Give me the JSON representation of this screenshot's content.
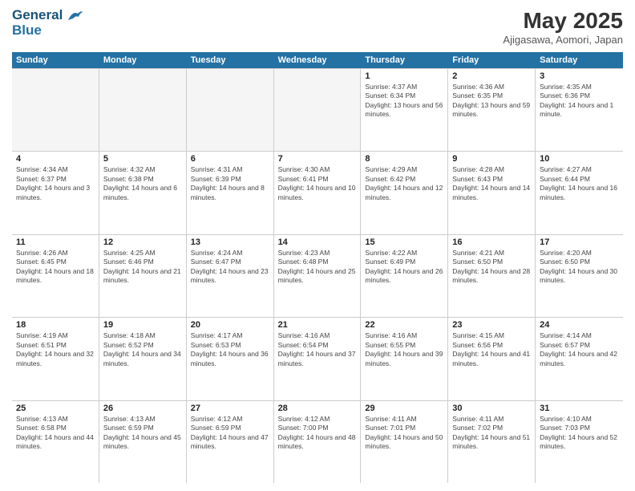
{
  "header": {
    "logo_line1": "General",
    "logo_line2": "Blue",
    "month": "May 2025",
    "location": "Ajigasawa, Aomori, Japan"
  },
  "days_of_week": [
    "Sunday",
    "Monday",
    "Tuesday",
    "Wednesday",
    "Thursday",
    "Friday",
    "Saturday"
  ],
  "rows": [
    [
      {
        "day": "",
        "empty": true
      },
      {
        "day": "",
        "empty": true
      },
      {
        "day": "",
        "empty": true
      },
      {
        "day": "",
        "empty": true
      },
      {
        "day": "1",
        "sunrise": "Sunrise: 4:37 AM",
        "sunset": "Sunset: 6:34 PM",
        "daylight": "Daylight: 13 hours and 56 minutes."
      },
      {
        "day": "2",
        "sunrise": "Sunrise: 4:36 AM",
        "sunset": "Sunset: 6:35 PM",
        "daylight": "Daylight: 13 hours and 59 minutes."
      },
      {
        "day": "3",
        "sunrise": "Sunrise: 4:35 AM",
        "sunset": "Sunset: 6:36 PM",
        "daylight": "Daylight: 14 hours and 1 minute."
      }
    ],
    [
      {
        "day": "4",
        "sunrise": "Sunrise: 4:34 AM",
        "sunset": "Sunset: 6:37 PM",
        "daylight": "Daylight: 14 hours and 3 minutes."
      },
      {
        "day": "5",
        "sunrise": "Sunrise: 4:32 AM",
        "sunset": "Sunset: 6:38 PM",
        "daylight": "Daylight: 14 hours and 6 minutes."
      },
      {
        "day": "6",
        "sunrise": "Sunrise: 4:31 AM",
        "sunset": "Sunset: 6:39 PM",
        "daylight": "Daylight: 14 hours and 8 minutes."
      },
      {
        "day": "7",
        "sunrise": "Sunrise: 4:30 AM",
        "sunset": "Sunset: 6:41 PM",
        "daylight": "Daylight: 14 hours and 10 minutes."
      },
      {
        "day": "8",
        "sunrise": "Sunrise: 4:29 AM",
        "sunset": "Sunset: 6:42 PM",
        "daylight": "Daylight: 14 hours and 12 minutes."
      },
      {
        "day": "9",
        "sunrise": "Sunrise: 4:28 AM",
        "sunset": "Sunset: 6:43 PM",
        "daylight": "Daylight: 14 hours and 14 minutes."
      },
      {
        "day": "10",
        "sunrise": "Sunrise: 4:27 AM",
        "sunset": "Sunset: 6:44 PM",
        "daylight": "Daylight: 14 hours and 16 minutes."
      }
    ],
    [
      {
        "day": "11",
        "sunrise": "Sunrise: 4:26 AM",
        "sunset": "Sunset: 6:45 PM",
        "daylight": "Daylight: 14 hours and 18 minutes."
      },
      {
        "day": "12",
        "sunrise": "Sunrise: 4:25 AM",
        "sunset": "Sunset: 6:46 PM",
        "daylight": "Daylight: 14 hours and 21 minutes."
      },
      {
        "day": "13",
        "sunrise": "Sunrise: 4:24 AM",
        "sunset": "Sunset: 6:47 PM",
        "daylight": "Daylight: 14 hours and 23 minutes."
      },
      {
        "day": "14",
        "sunrise": "Sunrise: 4:23 AM",
        "sunset": "Sunset: 6:48 PM",
        "daylight": "Daylight: 14 hours and 25 minutes."
      },
      {
        "day": "15",
        "sunrise": "Sunrise: 4:22 AM",
        "sunset": "Sunset: 6:49 PM",
        "daylight": "Daylight: 14 hours and 26 minutes."
      },
      {
        "day": "16",
        "sunrise": "Sunrise: 4:21 AM",
        "sunset": "Sunset: 6:50 PM",
        "daylight": "Daylight: 14 hours and 28 minutes."
      },
      {
        "day": "17",
        "sunrise": "Sunrise: 4:20 AM",
        "sunset": "Sunset: 6:50 PM",
        "daylight": "Daylight: 14 hours and 30 minutes."
      }
    ],
    [
      {
        "day": "18",
        "sunrise": "Sunrise: 4:19 AM",
        "sunset": "Sunset: 6:51 PM",
        "daylight": "Daylight: 14 hours and 32 minutes."
      },
      {
        "day": "19",
        "sunrise": "Sunrise: 4:18 AM",
        "sunset": "Sunset: 6:52 PM",
        "daylight": "Daylight: 14 hours and 34 minutes."
      },
      {
        "day": "20",
        "sunrise": "Sunrise: 4:17 AM",
        "sunset": "Sunset: 6:53 PM",
        "daylight": "Daylight: 14 hours and 36 minutes."
      },
      {
        "day": "21",
        "sunrise": "Sunrise: 4:16 AM",
        "sunset": "Sunset: 6:54 PM",
        "daylight": "Daylight: 14 hours and 37 minutes."
      },
      {
        "day": "22",
        "sunrise": "Sunrise: 4:16 AM",
        "sunset": "Sunset: 6:55 PM",
        "daylight": "Daylight: 14 hours and 39 minutes."
      },
      {
        "day": "23",
        "sunrise": "Sunrise: 4:15 AM",
        "sunset": "Sunset: 6:56 PM",
        "daylight": "Daylight: 14 hours and 41 minutes."
      },
      {
        "day": "24",
        "sunrise": "Sunrise: 4:14 AM",
        "sunset": "Sunset: 6:57 PM",
        "daylight": "Daylight: 14 hours and 42 minutes."
      }
    ],
    [
      {
        "day": "25",
        "sunrise": "Sunrise: 4:13 AM",
        "sunset": "Sunset: 6:58 PM",
        "daylight": "Daylight: 14 hours and 44 minutes."
      },
      {
        "day": "26",
        "sunrise": "Sunrise: 4:13 AM",
        "sunset": "Sunset: 6:59 PM",
        "daylight": "Daylight: 14 hours and 45 minutes."
      },
      {
        "day": "27",
        "sunrise": "Sunrise: 4:12 AM",
        "sunset": "Sunset: 6:59 PM",
        "daylight": "Daylight: 14 hours and 47 minutes."
      },
      {
        "day": "28",
        "sunrise": "Sunrise: 4:12 AM",
        "sunset": "Sunset: 7:00 PM",
        "daylight": "Daylight: 14 hours and 48 minutes."
      },
      {
        "day": "29",
        "sunrise": "Sunrise: 4:11 AM",
        "sunset": "Sunset: 7:01 PM",
        "daylight": "Daylight: 14 hours and 50 minutes."
      },
      {
        "day": "30",
        "sunrise": "Sunrise: 4:11 AM",
        "sunset": "Sunset: 7:02 PM",
        "daylight": "Daylight: 14 hours and 51 minutes."
      },
      {
        "day": "31",
        "sunrise": "Sunrise: 4:10 AM",
        "sunset": "Sunset: 7:03 PM",
        "daylight": "Daylight: 14 hours and 52 minutes."
      }
    ]
  ]
}
